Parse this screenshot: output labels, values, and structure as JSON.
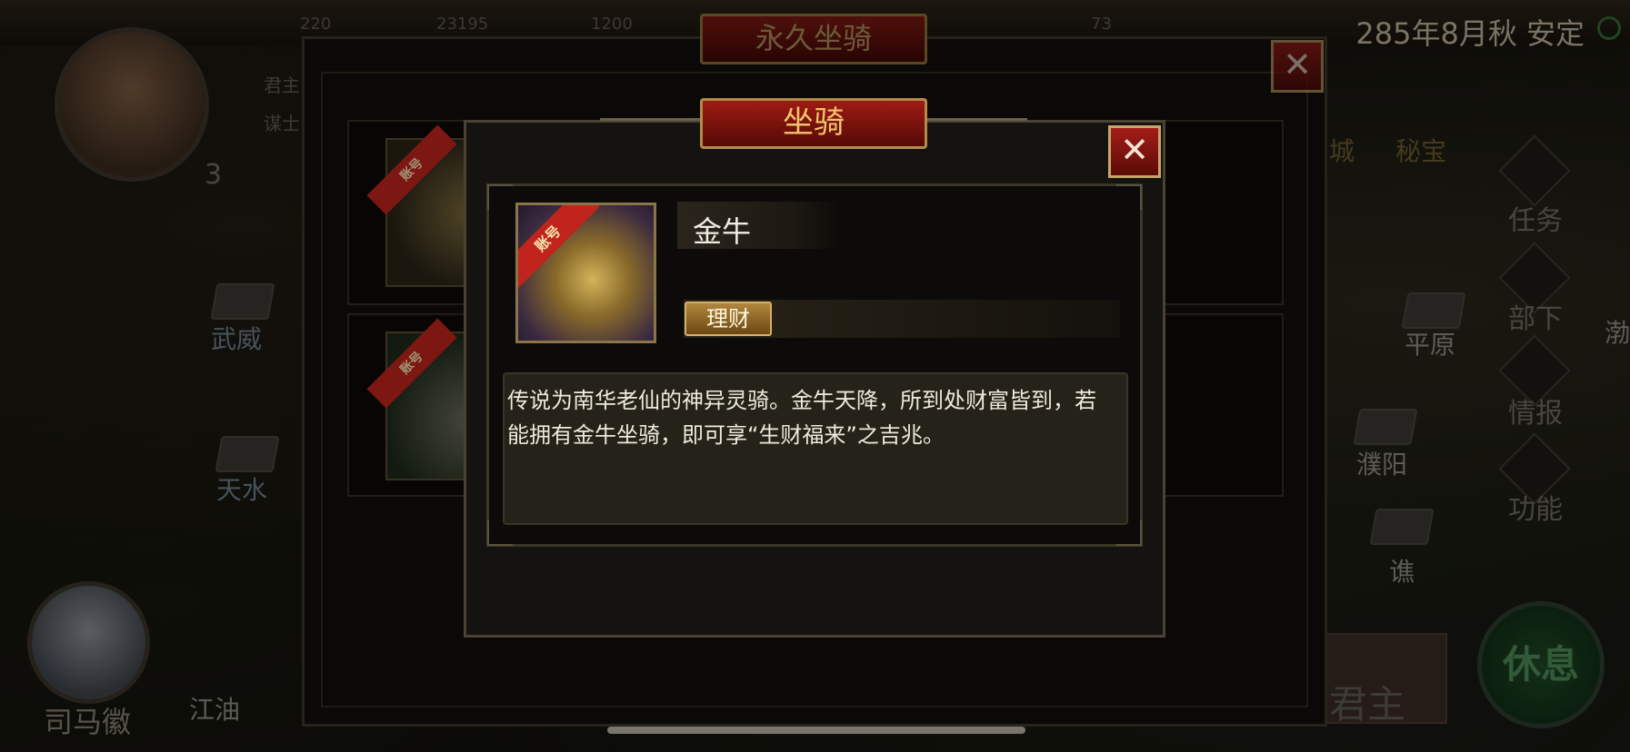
{
  "topbar": {
    "resources": [
      "220",
      "23195",
      "1200",
      "73"
    ],
    "date_status": "285年8月秋 安定"
  },
  "left_hud": {
    "lord_level": "3",
    "lord_tags": [
      "君主",
      "谋士"
    ],
    "advisor_name": "司马徽",
    "cities": [
      "武威",
      "天水",
      "江油"
    ]
  },
  "right_hud": {
    "top_labels": [
      "城",
      "秘宝"
    ],
    "menu": [
      "任务",
      "部下",
      "情报",
      "功能"
    ],
    "cities": [
      "平原",
      "濮阳",
      "谯",
      "渤"
    ],
    "lord_label": "君主",
    "rest_button": "休息"
  },
  "outer_dialog": {
    "title": "永久坐骑",
    "close_label": "✕",
    "slots": [
      {
        "ribbon": "账号"
      },
      {
        "ribbon": "账号"
      }
    ]
  },
  "inner_dialog": {
    "title": "坐骑",
    "close_label": "✕",
    "mount": {
      "ribbon": "账号",
      "name": "金牛",
      "tag": "理财",
      "description": "传说为南华老仙的神异灵骑。金牛天降，所到处财富皆到，若能拥有金牛坐骑，即可享“生财福来”之吉兆。"
    }
  }
}
